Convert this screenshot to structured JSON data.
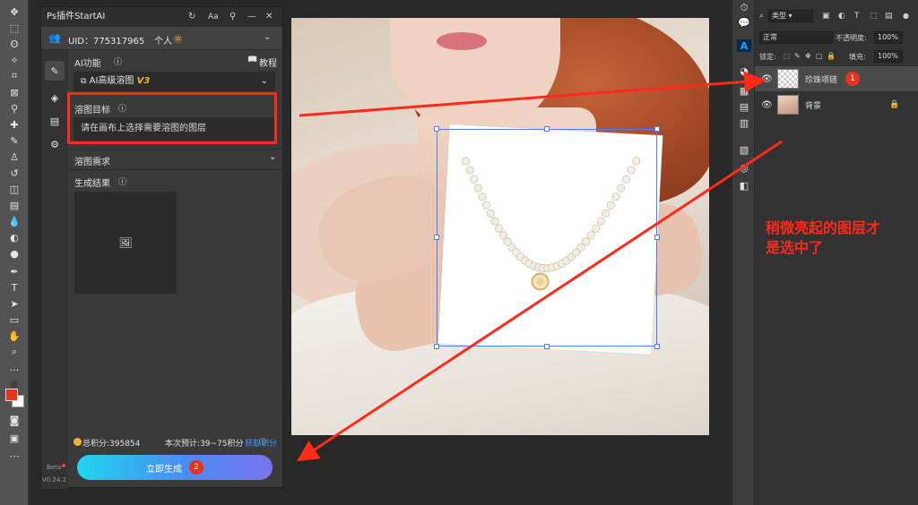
{
  "plugin": {
    "title": "Ps插件StartAI",
    "uid": "UID：775317965",
    "account_label": "个人",
    "account_badge": "㊥",
    "ai_function_label": "AI功能",
    "tutorial_label": "教程",
    "mode_select": "AI高级溶图",
    "mode_version": "V3",
    "target_label": "溶图目标",
    "target_placeholder": "请在画布上选择需要溶图的图层",
    "needs_label": "溶图需求",
    "result_label": "生成结果",
    "points_text": "总积分:395854",
    "estimate_text": "本次预计:39~75积分",
    "get_points_link": "获取积分",
    "generate_button": "立即生成",
    "generate_badge": "2",
    "beta_label": "Beta",
    "version_label": "V0.24.2"
  },
  "layers_panel": {
    "filter_kind": "类型",
    "blend_mode": "正常",
    "opacity_label": "不透明度:",
    "opacity_value": "100%",
    "lock_label": "锁定:",
    "fill_label": "填充:",
    "fill_value": "100%",
    "layers": [
      {
        "name": "珍珠项链",
        "badge": "1",
        "active": true
      },
      {
        "name": "背景",
        "active": false
      }
    ]
  },
  "annotation": {
    "line1": "稍微亮起的图层才",
    "line2": "是选中了"
  },
  "colors": {
    "accent_red": "#ff2a1a",
    "foreground_swatch": "#e8331a",
    "selection_blue": "#4a7dff",
    "button_gradient_start": "#1fd6ee",
    "button_gradient_end": "#7a74ee",
    "link_blue": "#3d9bff",
    "version_gold": "#f2b13a"
  },
  "icons": {
    "toolbar": [
      "move-icon",
      "marquee-icon",
      "lasso-icon",
      "magic-wand-icon",
      "crop-icon",
      "frame-icon",
      "eyedropper-icon",
      "healing-icon",
      "brush-icon",
      "stamp-icon",
      "history-brush-icon",
      "eraser-icon",
      "gradient-icon",
      "blur-icon",
      "dodge-icon",
      "pen-icon",
      "type-icon",
      "path-select-icon",
      "shape-icon",
      "hand-icon",
      "zoom-icon",
      "more-icon"
    ]
  }
}
